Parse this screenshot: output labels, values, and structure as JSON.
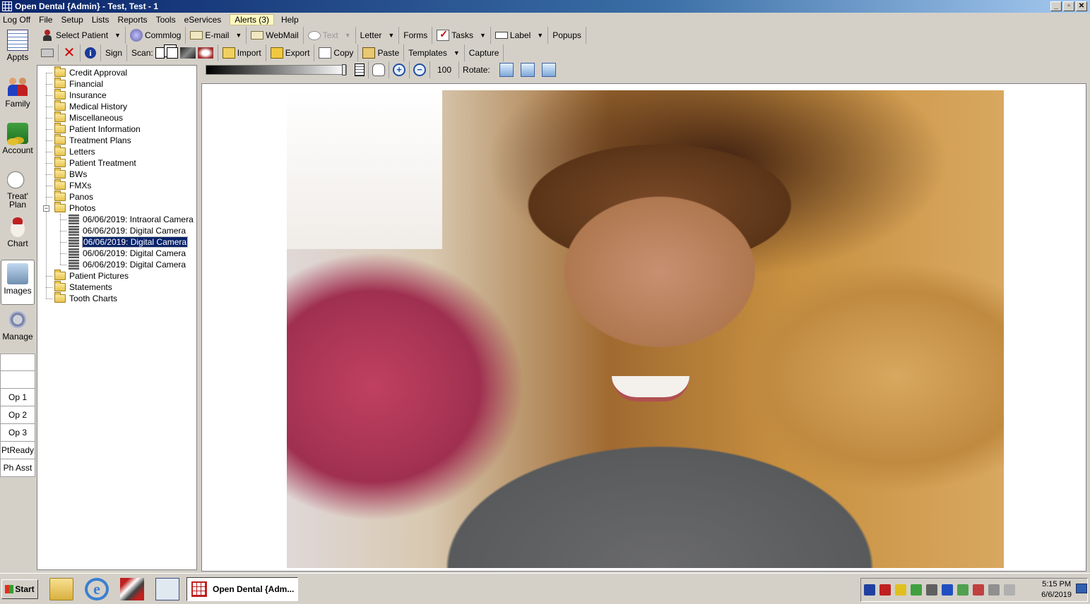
{
  "window": {
    "title": "Open Dental {Admin} - Test, Test - 1",
    "controls": [
      "_",
      "▫",
      "✕"
    ]
  },
  "menu": [
    "Log Off",
    "File",
    "Setup",
    "Lists",
    "Reports",
    "Tools",
    "eServices",
    "Alerts (3)",
    "Help"
  ],
  "toolbar_main": {
    "select_patient": "Select Patient",
    "commlog": "Commlog",
    "email": "E-mail",
    "webmail": "WebMail",
    "text": "Text",
    "letter": "Letter",
    "forms": "Forms",
    "tasks": "Tasks",
    "label": "Label",
    "popups": "Popups"
  },
  "toolbar_images": {
    "sign": "Sign",
    "scan": "Scan:",
    "import": "Import",
    "export": "Export",
    "copy": "Copy",
    "paste": "Paste",
    "templates": "Templates",
    "capture": "Capture"
  },
  "image_toolbar": {
    "zoom_value": "100",
    "rotate_label": "Rotate:",
    "brightness_level": 1.0
  },
  "modules": [
    {
      "label": "Appts",
      "icon": "calendar-icon"
    },
    {
      "label": "Family",
      "icon": "family-icon"
    },
    {
      "label": "Account",
      "icon": "money-icon"
    },
    {
      "label": "Treat' Plan",
      "icon": "treatment-plan-icon"
    },
    {
      "label": "Chart",
      "icon": "tooth-chart-icon"
    },
    {
      "label": "Images",
      "icon": "images-icon",
      "selected": true
    },
    {
      "label": "Manage",
      "icon": "gears-icon"
    }
  ],
  "ops": [
    "",
    "",
    "Op 1",
    "Op 2",
    "Op 3",
    "PtReady",
    "Ph Asst"
  ],
  "tree": {
    "folders_before": [
      "Credit Approval",
      "Financial",
      "Insurance",
      "Medical History",
      "Miscellaneous",
      "Patient Information",
      "Treatment Plans",
      "Letters",
      "Patient Treatment",
      "BWs",
      "FMXs",
      "Panos"
    ],
    "expanded_folder": "Photos",
    "expander": "−",
    "documents": [
      {
        "label": "06/06/2019: Intraoral Camera",
        "selected": false
      },
      {
        "label": "06/06/2019: Digital Camera",
        "selected": false
      },
      {
        "label": "06/06/2019: Digital Camera",
        "selected": true
      },
      {
        "label": "06/06/2019: Digital Camera",
        "selected": false
      },
      {
        "label": "06/06/2019: Digital Camera",
        "selected": false
      }
    ],
    "folders_after": [
      "Patient Pictures",
      "Statements",
      "Tooth Charts"
    ]
  },
  "taskbar": {
    "start": "Start",
    "active_app": "Open Dental {Adm...",
    "time": "5:15 PM",
    "date": "6/6/2019"
  },
  "colors": {
    "title_start": "#0a246a",
    "title_end": "#a6caf0",
    "selection": "#0a246a",
    "chrome": "#d4d0c8"
  }
}
